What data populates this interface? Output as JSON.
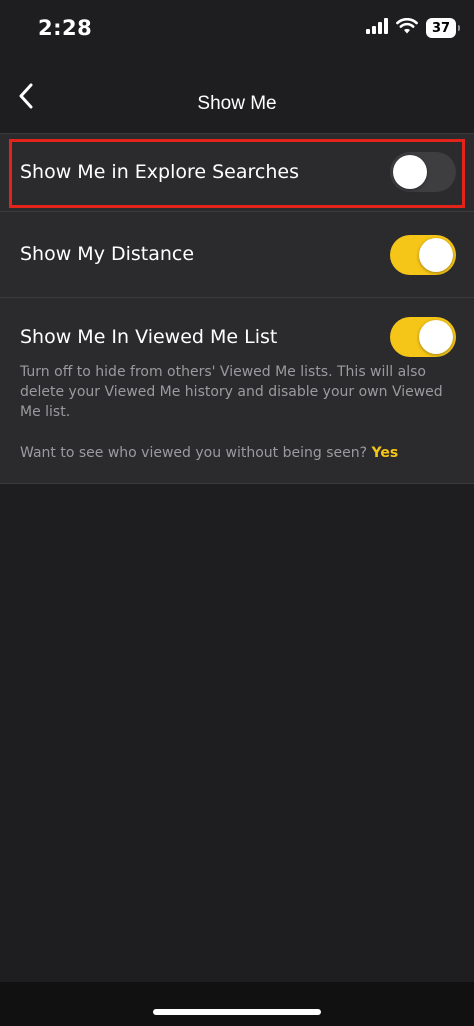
{
  "status_bar": {
    "time": "2:28",
    "battery_level": "37",
    "icons": [
      "cellular-signal-icon",
      "wifi-icon",
      "battery-icon"
    ]
  },
  "nav": {
    "back_icon": "chevron-left-icon",
    "title": "Show Me"
  },
  "settings": {
    "explore_searches": {
      "label": "Show Me in Explore Searches",
      "enabled": false
    },
    "my_distance": {
      "label": "Show My Distance",
      "enabled": true
    },
    "viewed_me_list": {
      "label": "Show Me In Viewed Me List",
      "enabled": true,
      "description": "Turn off to hide from others' Viewed Me lists. This will also delete your Viewed Me history and disable your own Viewed Me list.",
      "cta_text": "Want to see who viewed you without being seen?",
      "cta_link": "Yes"
    }
  },
  "colors": {
    "background": "#1e1e20",
    "row_background": "#2b2b2d",
    "accent_yellow": "#f5c518",
    "toggle_off": "#3e3e41",
    "highlight_red": "#e3241b",
    "secondary_text": "#9b9b9f"
  }
}
